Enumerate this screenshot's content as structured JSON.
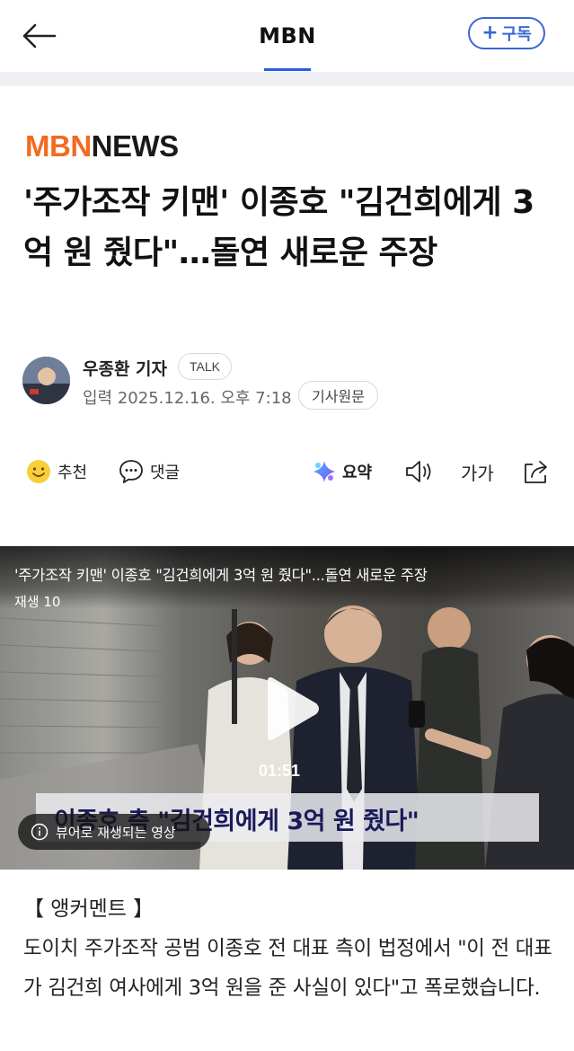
{
  "topbar": {
    "back_icon": "arrow-left-icon",
    "brand": "MBN",
    "subscribe_label": "구독",
    "subscribe_icon": "plus-icon",
    "accent_color": "#3a66d6"
  },
  "article": {
    "source_logo": "MBN NEWS",
    "headline": "'주가조작 키맨' 이종호 \"김건희에게 3억 원 줬다\"…돌연 새로운 주장",
    "reporter": {
      "name": "우종환 기자",
      "talk_label": "TALK",
      "publish_date": "입력 2025.12.16. 오후 7:18",
      "original_label": "기사원문"
    }
  },
  "actions": {
    "recommend_label": "추천",
    "comment_label": "댓글",
    "summary_label": "요약",
    "fontsize_label": "가가",
    "icons": [
      "smile-icon",
      "comment-icon",
      "sparkle-icon",
      "speaker-icon",
      "share-icon"
    ]
  },
  "video": {
    "title": "'주가조작 키맨' 이종호 \"김건희에게 3억 원 줬다\"...돌연 새로운 주장",
    "play_count": "재생 10",
    "duration": "01:51",
    "caption": "이종호 측 \"김건희에게 3억 원 줬다\"",
    "viewer_note": "뷰어로 재생되는 영상"
  },
  "body": {
    "anchor_tag": "【 앵커멘트 】",
    "paragraph": "도이치 주가조작 공범 이종호 전 대표 측이 법정에서 \"이 전 대표가 김건희 여사에게 3억 원을 준 사실이 있다\"고 폭로했습니다."
  }
}
